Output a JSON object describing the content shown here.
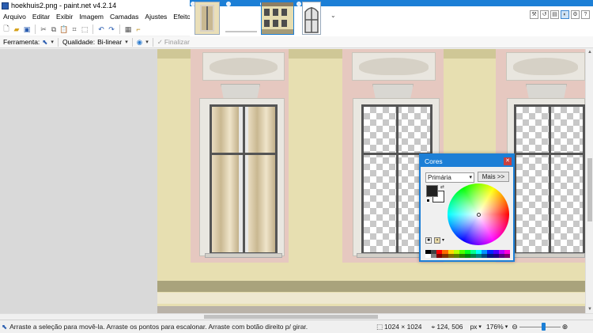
{
  "window": {
    "title": "hoekhuis2.png - paint.net v4.2.14"
  },
  "menu": {
    "items": [
      "Arquivo",
      "Editar",
      "Exibir",
      "Imagem",
      "Camadas",
      "Ajustes",
      "Efeitos"
    ]
  },
  "thumbnails": {
    "dropdown_icon": "chevron-down-icon"
  },
  "right_tools": [
    "tools-icon",
    "history-icon",
    "layers-icon",
    "colors-icon",
    "settings-icon",
    "help-icon"
  ],
  "toolbar_icons": [
    "new-icon",
    "open-icon",
    "save-icon",
    "cut-icon",
    "copy-icon",
    "paste-icon",
    "crop-icon",
    "deselect-icon",
    "undo-icon",
    "redo-icon",
    "grid-icon",
    "ruler-icon"
  ],
  "options": {
    "tool_label": "Ferramenta:",
    "quality_label": "Qualidade:",
    "quality_value": "Bi-linear",
    "finalize_label": "Finalizar"
  },
  "colors_window": {
    "title": "Cores",
    "mode": "Primária",
    "more_button": "Mais >>",
    "primary_color": "#222222",
    "secondary_color": "#ffffff",
    "palette": [
      "#000000",
      "#404040",
      "#ff0000",
      "#ff6a00",
      "#ffd800",
      "#b6ff00",
      "#4cff00",
      "#00ff21",
      "#00ff90",
      "#00ffff",
      "#0094ff",
      "#0026ff",
      "#4800ff",
      "#b200ff",
      "#ff00dc",
      "#ffffff",
      "#808080",
      "#7f0000",
      "#7f3300",
      "#7f6a00",
      "#5b7f00",
      "#267f00",
      "#007f0e",
      "#007f46",
      "#007f7f",
      "#004a7f",
      "#00137f",
      "#21007f",
      "#57007f",
      "#7f006e"
    ]
  },
  "status": {
    "hint": "Arraste a seleção para movê-la. Arraste os pontos para escalonar. Arraste com botão direito p/ girar.",
    "image_size": "1024 × 1024",
    "cursor_position": "124, 506",
    "units": "px",
    "zoom": "176%"
  }
}
